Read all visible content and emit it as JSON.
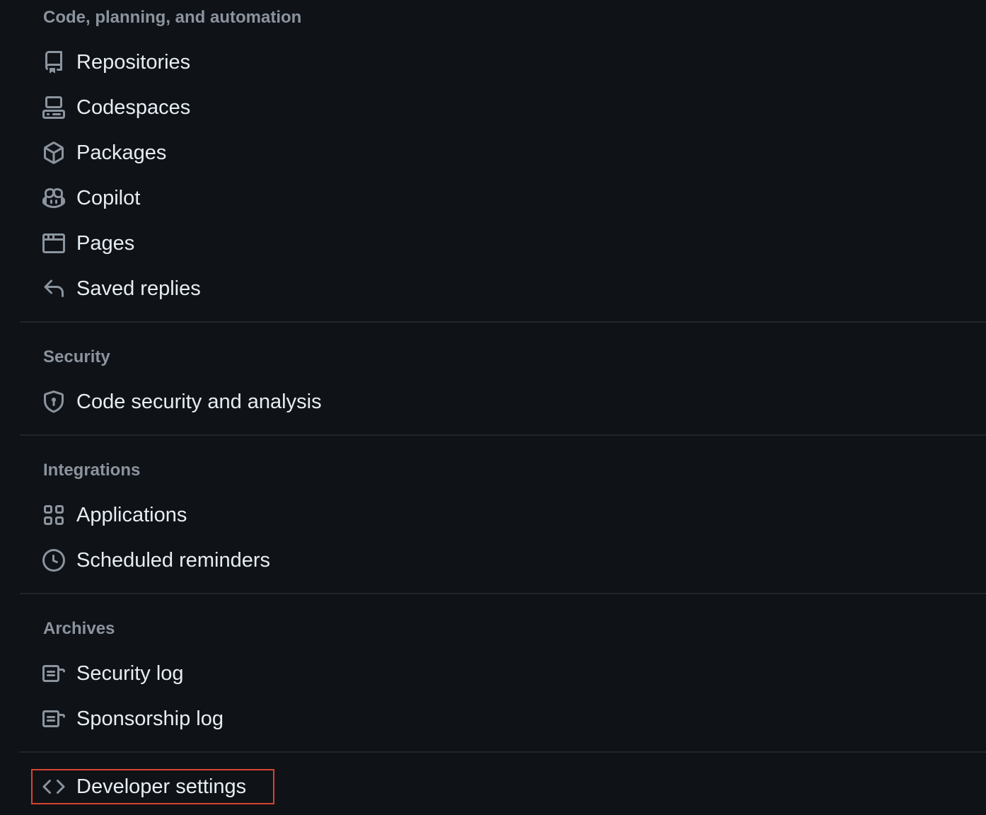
{
  "sections": {
    "code": {
      "header": "Code, planning, and automation",
      "items": [
        {
          "label": "Repositories",
          "icon": "repo-icon"
        },
        {
          "label": "Codespaces",
          "icon": "codespaces-icon"
        },
        {
          "label": "Packages",
          "icon": "package-icon"
        },
        {
          "label": "Copilot",
          "icon": "copilot-icon"
        },
        {
          "label": "Pages",
          "icon": "browser-icon"
        },
        {
          "label": "Saved replies",
          "icon": "reply-icon"
        }
      ]
    },
    "security": {
      "header": "Security",
      "items": [
        {
          "label": "Code security and analysis",
          "icon": "shield-lock-icon"
        }
      ]
    },
    "integrations": {
      "header": "Integrations",
      "items": [
        {
          "label": "Applications",
          "icon": "apps-icon"
        },
        {
          "label": "Scheduled reminders",
          "icon": "clock-icon"
        }
      ]
    },
    "archives": {
      "header": "Archives",
      "items": [
        {
          "label": "Security log",
          "icon": "log-icon"
        },
        {
          "label": "Sponsorship log",
          "icon": "log-icon"
        }
      ]
    }
  },
  "developer": {
    "label": "Developer settings",
    "icon": "code-icon"
  },
  "colors": {
    "background": "#0f1217",
    "text": "#e6edf3",
    "muted": "#8b949e",
    "divider": "#21262d",
    "highlight": "#d9432f"
  }
}
